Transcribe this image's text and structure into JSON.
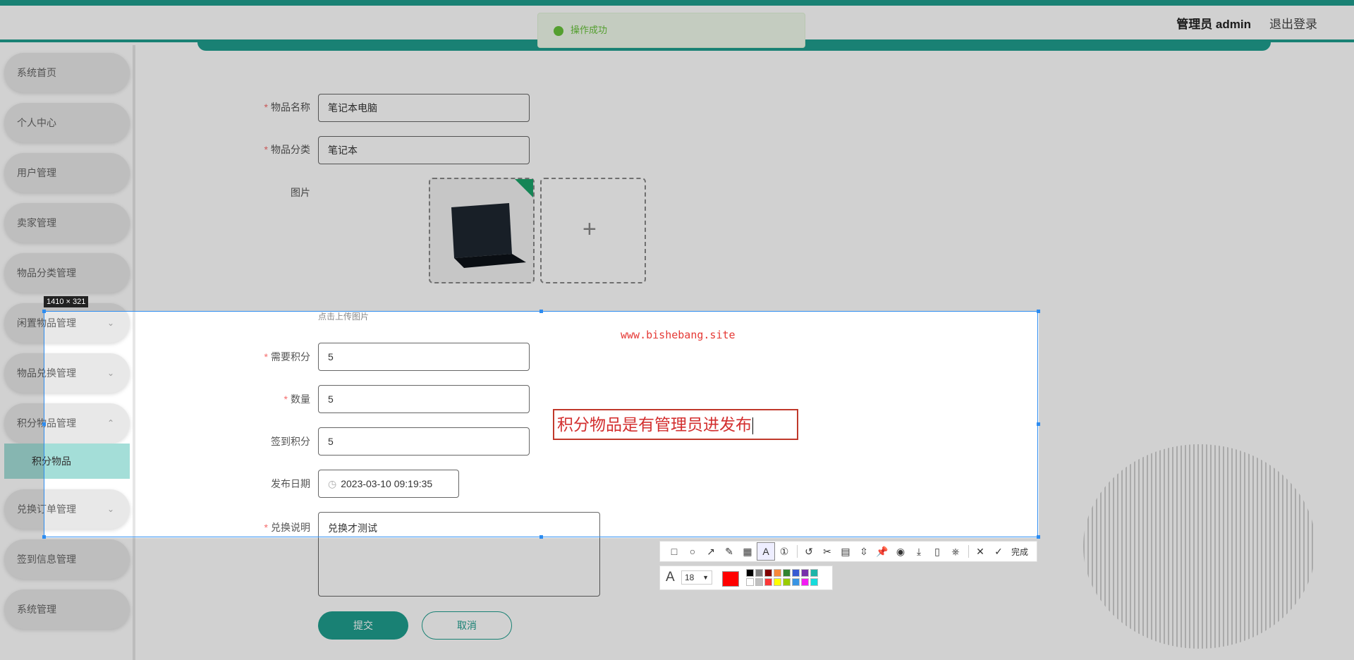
{
  "header": {
    "user_label": "管理员 admin",
    "logout_label": "退出登录"
  },
  "toast": {
    "text": "操作成功"
  },
  "sidebar": {
    "items": [
      {
        "label": "系统首页",
        "has_children": false
      },
      {
        "label": "个人中心",
        "has_children": false
      },
      {
        "label": "用户管理",
        "has_children": false
      },
      {
        "label": "卖家管理",
        "has_children": false
      },
      {
        "label": "物品分类管理",
        "has_children": false
      },
      {
        "label": "闲置物品管理",
        "has_children": true
      },
      {
        "label": "物品兑换管理",
        "has_children": true
      },
      {
        "label": "积分物品管理",
        "has_children": true
      },
      {
        "label": "兑换订单管理",
        "has_children": true
      },
      {
        "label": "签到信息管理",
        "has_children": false
      },
      {
        "label": "系统管理",
        "has_children": false
      }
    ],
    "active_sub_item": "积分物品"
  },
  "form": {
    "name": {
      "label": "物品名称",
      "value": "笔记本电脑",
      "required": true
    },
    "category": {
      "label": "物品分类",
      "value": "笔记本",
      "required": true
    },
    "image": {
      "label": "图片",
      "upload_tip": "点击上传图片",
      "add_icon": "plus-icon"
    },
    "points": {
      "label": "需要积分",
      "value": "5",
      "required": true
    },
    "quantity": {
      "label": "数量",
      "value": "5",
      "required": true
    },
    "signin_points": {
      "label": "签到积分",
      "value": "5",
      "required": false
    },
    "publish_date": {
      "label": "发布日期",
      "value": "2023-03-10 09:19:35",
      "icon": "clock-icon"
    },
    "description": {
      "label": "兑换说明",
      "value": "兑换才测试",
      "required": true
    },
    "submit_label": "提交",
    "cancel_label": "取消"
  },
  "capture": {
    "size_label": "1410 × 321",
    "watermark": "www.bishebang.site",
    "annotation_text": "积分物品是有管理员进发布",
    "font_size": "18",
    "done_label": "完成",
    "tools": [
      "rectangle-icon",
      "ellipse-icon",
      "arrow-icon",
      "pen-icon",
      "mosaic-icon",
      "text-icon",
      "serial-number-icon",
      "undo-icon",
      "crop-icon",
      "ocr-icon",
      "scroll-capture-icon",
      "pin-icon",
      "record-icon",
      "download-icon",
      "phone-icon",
      "bookmark-icon"
    ],
    "current_color": "#ff0000",
    "palette": [
      "#000000",
      "#808080",
      "#800000",
      "#f7883a",
      "#308430",
      "#385ad3",
      "#772fab",
      "#1eb5a8",
      "#ffffff",
      "#c0c0c0",
      "#fb3838",
      "#ffff00",
      "#99cc00",
      "#3894e4",
      "#f31bf3",
      "#16dcdc"
    ]
  }
}
